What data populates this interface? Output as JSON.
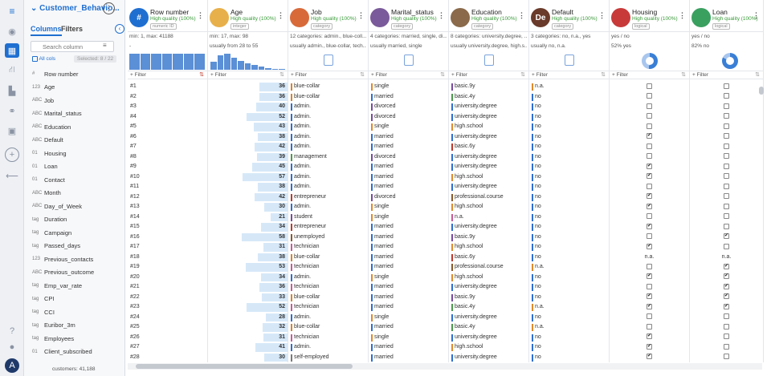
{
  "app": {
    "dataset_title": "Customer_Behavio...",
    "tabs": [
      "Columns",
      "Filters"
    ],
    "search_placeholder": "Search column",
    "all_cols_label": "All cols",
    "selected_label": "Selected: 8 / 22",
    "customers_count": "customers: 41,188"
  },
  "rail_icons": [
    "eye-icon",
    "table-icon",
    "flow-icon",
    "chart-icon",
    "network-icon",
    "layout-icon",
    "plus-icon",
    "back-icon"
  ],
  "columns_list": [
    {
      "name": "Row number",
      "icon": "#"
    },
    {
      "name": "Age",
      "icon": "123"
    },
    {
      "name": "Job",
      "icon": "ABC"
    },
    {
      "name": "Marital_status",
      "icon": "ABC"
    },
    {
      "name": "Education",
      "icon": "ABC"
    },
    {
      "name": "Default",
      "icon": "ABC"
    },
    {
      "name": "Housing",
      "icon": "01"
    },
    {
      "name": "Loan",
      "icon": "01"
    },
    {
      "name": "Contact",
      "icon": "01"
    },
    {
      "name": "Month",
      "icon": "ABC"
    },
    {
      "name": "Day_of_Week",
      "icon": "ABC"
    },
    {
      "name": "Duration",
      "icon": "tag"
    },
    {
      "name": "Campaign",
      "icon": "tag"
    },
    {
      "name": "Passed_days",
      "icon": "tag"
    },
    {
      "name": "Previous_contacts",
      "icon": "123"
    },
    {
      "name": "Previous_outcome",
      "icon": "ABC"
    },
    {
      "name": "Emp_var_rate",
      "icon": "tag"
    },
    {
      "name": "CPI",
      "icon": "tag"
    },
    {
      "name": "CCI",
      "icon": "tag"
    },
    {
      "name": "Euribor_3m",
      "icon": "tag"
    },
    {
      "name": "Employees",
      "icon": "tag"
    },
    {
      "name": "Client_subscribed",
      "icon": "01"
    }
  ],
  "grid_headers": [
    {
      "name": "Row number",
      "quality": "High quality (100%)",
      "type": "numeric ID",
      "stat1": "min: 1, max: 41188",
      "stat2": "-",
      "icon_text": "#",
      "icon_color": "#1f6fd1"
    },
    {
      "name": "Age",
      "quality": "High quality (100%)",
      "type": "integer",
      "stat1": "min: 17, max: 98",
      "stat2": "usually from 28 to 55",
      "icon_text": "",
      "icon_color": "#e8b04a"
    },
    {
      "name": "Job",
      "quality": "High quality (100%)",
      "type": "category",
      "stat1": "12 categories: admin., blue-coll...",
      "stat2": "usually admin., blue-collar, tech...",
      "icon_text": "",
      "icon_color": "#d86a3a"
    },
    {
      "name": "Marital_status",
      "quality": "High quality (100%)",
      "type": "category",
      "stat1": "4 categories: married, single, di...",
      "stat2": "usually married, single",
      "icon_text": "",
      "icon_color": "#7a5a9a"
    },
    {
      "name": "Education",
      "quality": "High quality (100%)",
      "type": "category",
      "stat1": "8 categories: university.degree, ...",
      "stat2": "usually university.degree, high.s...",
      "icon_text": "",
      "icon_color": "#8a6a4a"
    },
    {
      "name": "Default",
      "quality": "High quality (100%)",
      "type": "category",
      "stat1": "3 categories: no, n.a., yes",
      "stat2": "usually no, n.a.",
      "icon_text": "De",
      "icon_color": "#6a3a2a"
    },
    {
      "name": "Housing",
      "quality": "High quality (100%)",
      "type": "logical",
      "stat1": "yes / no",
      "stat2": "52% yes",
      "icon_text": "",
      "icon_color": "#c83a3a"
    },
    {
      "name": "Loan",
      "quality": "High quality (100%)",
      "type": "logical",
      "stat1": "yes / no",
      "stat2": "82% no",
      "icon_text": "",
      "icon_color": "#3aa060"
    }
  ],
  "filter_label": "Filter",
  "rows": [
    {
      "id": "#1",
      "age": "36",
      "job": "blue-collar",
      "marital": "single",
      "edu": "basic.9y",
      "def": "n.a.",
      "housing": "no",
      "loan": "no"
    },
    {
      "id": "#2",
      "age": "36",
      "job": "blue-collar",
      "marital": "married",
      "edu": "basic.4y",
      "def": "no",
      "housing": "no",
      "loan": "no"
    },
    {
      "id": "#3",
      "age": "40",
      "job": "admin.",
      "marital": "divorced",
      "edu": "university.degree",
      "def": "no",
      "housing": "no",
      "loan": "no"
    },
    {
      "id": "#4",
      "age": "52",
      "job": "admin.",
      "marital": "divorced",
      "edu": "university.degree",
      "def": "no",
      "housing": "no",
      "loan": "no"
    },
    {
      "id": "#5",
      "age": "43",
      "job": "admin.",
      "marital": "single",
      "edu": "high.school",
      "def": "no",
      "housing": "no",
      "loan": "no"
    },
    {
      "id": "#6",
      "age": "38",
      "job": "admin.",
      "marital": "married",
      "edu": "university.degree",
      "def": "no",
      "housing": "yes",
      "loan": "no"
    },
    {
      "id": "#7",
      "age": "42",
      "job": "admin.",
      "marital": "married",
      "edu": "basic.6y",
      "def": "no",
      "housing": "no",
      "loan": "no"
    },
    {
      "id": "#8",
      "age": "39",
      "job": "management",
      "marital": "divorced",
      "edu": "university.degree",
      "def": "no",
      "housing": "no",
      "loan": "no"
    },
    {
      "id": "#9",
      "age": "45",
      "job": "admin.",
      "marital": "married",
      "edu": "university.degree",
      "def": "no",
      "housing": "yes",
      "loan": "no"
    },
    {
      "id": "#10",
      "age": "57",
      "job": "admin.",
      "marital": "married",
      "edu": "high.school",
      "def": "no",
      "housing": "yes",
      "loan": "no"
    },
    {
      "id": "#11",
      "age": "38",
      "job": "admin.",
      "marital": "married",
      "edu": "university.degree",
      "def": "no",
      "housing": "no",
      "loan": "no"
    },
    {
      "id": "#12",
      "age": "42",
      "job": "entrepreneur",
      "marital": "divorced",
      "edu": "professional.course",
      "def": "no",
      "housing": "yes",
      "loan": "no"
    },
    {
      "id": "#13",
      "age": "30",
      "job": "admin.",
      "marital": "single",
      "edu": "high.school",
      "def": "no",
      "housing": "yes",
      "loan": "no"
    },
    {
      "id": "#14",
      "age": "21",
      "job": "student",
      "marital": "single",
      "edu": "n.a.",
      "def": "no",
      "housing": "no",
      "loan": "no"
    },
    {
      "id": "#15",
      "age": "34",
      "job": "entrepreneur",
      "marital": "married",
      "edu": "university.degree",
      "def": "no",
      "housing": "yes",
      "loan": "no"
    },
    {
      "id": "#16",
      "age": "58",
      "job": "unemployed",
      "marital": "married",
      "edu": "basic.9y",
      "def": "no",
      "housing": "no",
      "loan": "yes"
    },
    {
      "id": "#17",
      "age": "31",
      "job": "technician",
      "marital": "married",
      "edu": "high.school",
      "def": "no",
      "housing": "yes",
      "loan": "no"
    },
    {
      "id": "#18",
      "age": "38",
      "job": "blue-collar",
      "marital": "married",
      "edu": "basic.6y",
      "def": "no",
      "housing": "n.a.",
      "loan": "n.a."
    },
    {
      "id": "#19",
      "age": "53",
      "job": "technician",
      "marital": "married",
      "edu": "professional.course",
      "def": "n.a.",
      "housing": "no",
      "loan": "yes"
    },
    {
      "id": "#20",
      "age": "34",
      "job": "admin.",
      "marital": "single",
      "edu": "high.school",
      "def": "no",
      "housing": "yes",
      "loan": "yes"
    },
    {
      "id": "#21",
      "age": "36",
      "job": "technician",
      "marital": "married",
      "edu": "university.degree",
      "def": "no",
      "housing": "no",
      "loan": "yes"
    },
    {
      "id": "#22",
      "age": "33",
      "job": "blue-collar",
      "marital": "married",
      "edu": "basic.9y",
      "def": "no",
      "housing": "yes",
      "loan": "yes"
    },
    {
      "id": "#23",
      "age": "52",
      "job": "technician",
      "marital": "married",
      "edu": "basic.4y",
      "def": "n.a.",
      "housing": "yes",
      "loan": "yes"
    },
    {
      "id": "#24",
      "age": "28",
      "job": "admin.",
      "marital": "single",
      "edu": "university.degree",
      "def": "no",
      "housing": "no",
      "loan": "no"
    },
    {
      "id": "#25",
      "age": "32",
      "job": "blue-collar",
      "marital": "married",
      "edu": "basic.4y",
      "def": "n.a.",
      "housing": "no",
      "loan": "no"
    },
    {
      "id": "#26",
      "age": "31",
      "job": "technician",
      "marital": "single",
      "edu": "university.degree",
      "def": "no",
      "housing": "yes",
      "loan": "no"
    },
    {
      "id": "#27",
      "age": "41",
      "job": "admin.",
      "marital": "married",
      "edu": "high.school",
      "def": "no",
      "housing": "yes",
      "loan": "no"
    },
    {
      "id": "#28",
      "age": "30",
      "job": "self-employed",
      "marital": "married",
      "edu": "university.degree",
      "def": "no",
      "housing": "yes",
      "loan": "no"
    }
  ],
  "colors": {
    "accent": "#1f6fd1",
    "job": {
      "blue-collar": "#d9822b",
      "admin.": "#2d6fd2",
      "management": "#4a9a4a",
      "entrepreneur": "#c0392b",
      "student": "#7a4aa0",
      "unemployed": "#8a5a2a",
      "technician": "#c95a9a",
      "self-employed": "#7a7a7a"
    },
    "marital": {
      "single": "#e08a2a",
      "married": "#2d6fd2",
      "divorced": "#7a4aa0"
    },
    "edu": {
      "basic.9y": "#7a4aa0",
      "basic.4y": "#4a9a4a",
      "university.degree": "#2d6fd2",
      "high.school": "#e08a2a",
      "basic.6y": "#c0392b",
      "professional.course": "#8a5a2a",
      "n.a.": "#c95a9a"
    },
    "def": {
      "n.a.": "#e08a2a",
      "no": "#2d6fd2"
    }
  },
  "age_histogram": [
    0.5,
    0.9,
    1.0,
    0.75,
    0.55,
    0.4,
    0.3,
    0.2,
    0.12,
    0.06,
    0.03
  ],
  "housing_yes_pct": 52,
  "loan_no_pct": 82
}
